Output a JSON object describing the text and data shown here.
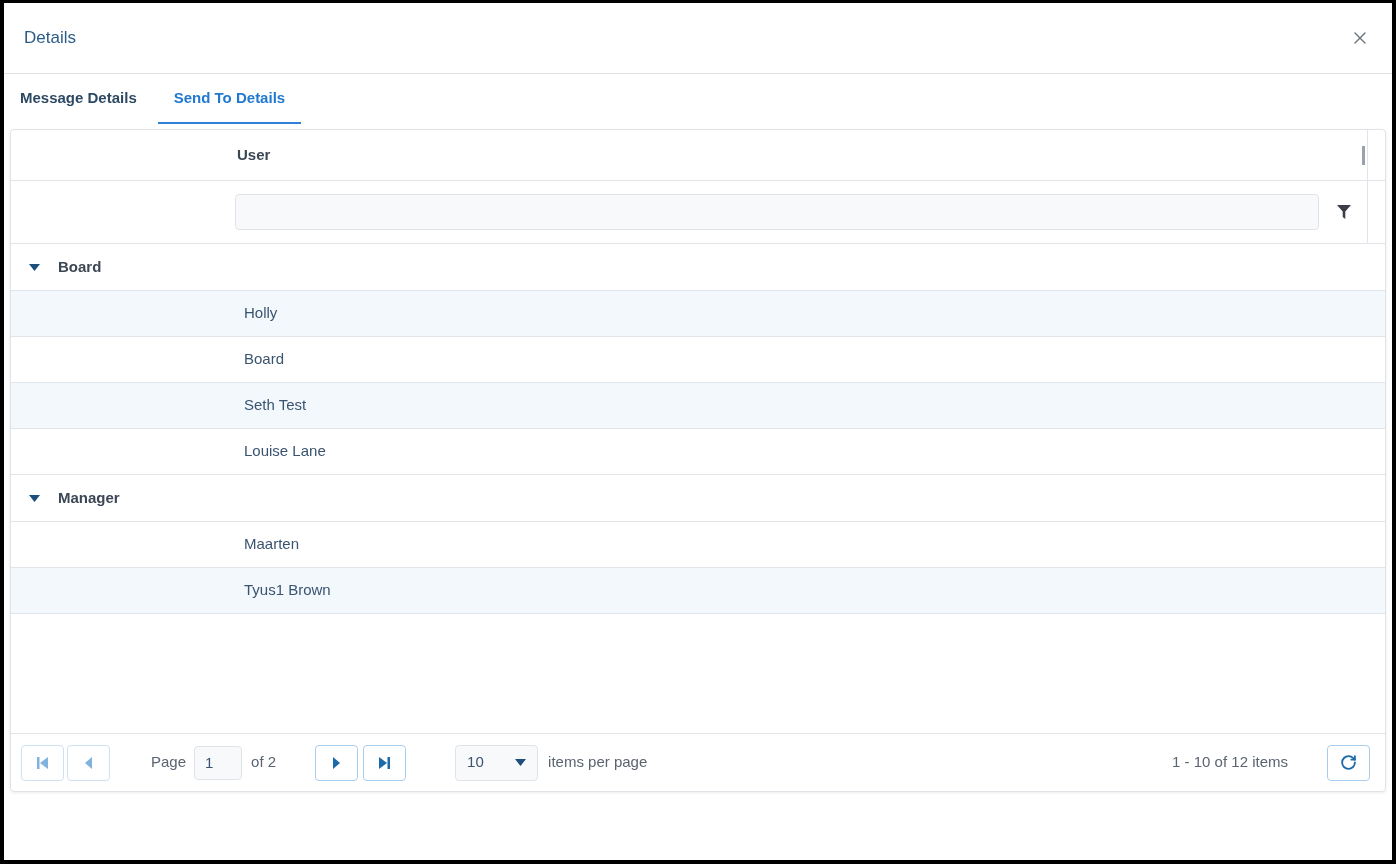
{
  "dialog": {
    "title": "Details"
  },
  "tabs": [
    {
      "label": "Message Details",
      "selected": false
    },
    {
      "label": "Send To Details",
      "selected": true
    }
  ],
  "grid": {
    "columns": [
      {
        "title": "User"
      }
    ],
    "groups": [
      {
        "name": "Board",
        "expanded": true,
        "rows": [
          "Holly",
          "Board",
          "Seth Test",
          "Louise Lane"
        ]
      },
      {
        "name": "Manager",
        "expanded": true,
        "rows": [
          "Maarten",
          "Tyus1 Brown"
        ]
      }
    ]
  },
  "pager": {
    "buttons": [
      {
        "kind": "first",
        "disabled": true
      },
      {
        "kind": "previous",
        "disabled": true
      },
      {
        "kind": "next",
        "disabled": false
      },
      {
        "kind": "last",
        "disabled": false
      }
    ],
    "page_label": "Page",
    "page_value": "1",
    "page_total": "of 2",
    "page_size": "10",
    "page_size_label": "items per page",
    "info": "1 - 10 of 12 items"
  }
}
